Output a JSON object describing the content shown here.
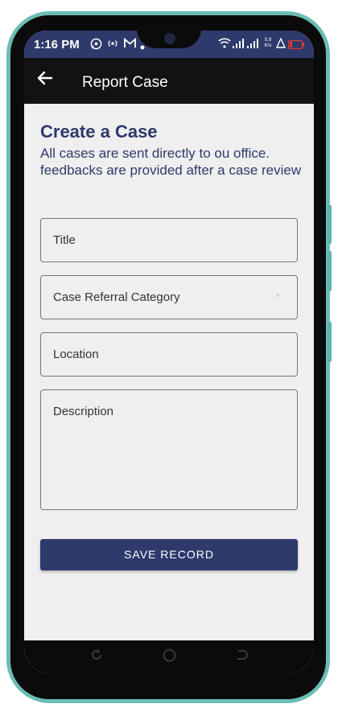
{
  "status_bar": {
    "time": "1:16 PM",
    "net_speed": "5.9 K/s",
    "icons": [
      "whatsapp-icon",
      "hotspot-icon",
      "gmail-icon",
      "dot-icon",
      "wifi-icon",
      "signal-icon",
      "signal-icon",
      "alert-icon",
      "battery-icon"
    ]
  },
  "app_bar": {
    "title": "Report Case",
    "back_icon": "arrow-left-icon"
  },
  "form": {
    "heading": "Create a Case",
    "subtitle": "All cases are sent directly to ou office. feedbacks are provided after a case review",
    "title_placeholder": "Title",
    "category_placeholder": "Case Referral Category",
    "location_placeholder": "Location",
    "description_placeholder": "Description",
    "save_label": "SAVE RECORD"
  },
  "colors": {
    "primary": "#2e3a6b",
    "background": "#efefef",
    "appbar": "#121212"
  }
}
